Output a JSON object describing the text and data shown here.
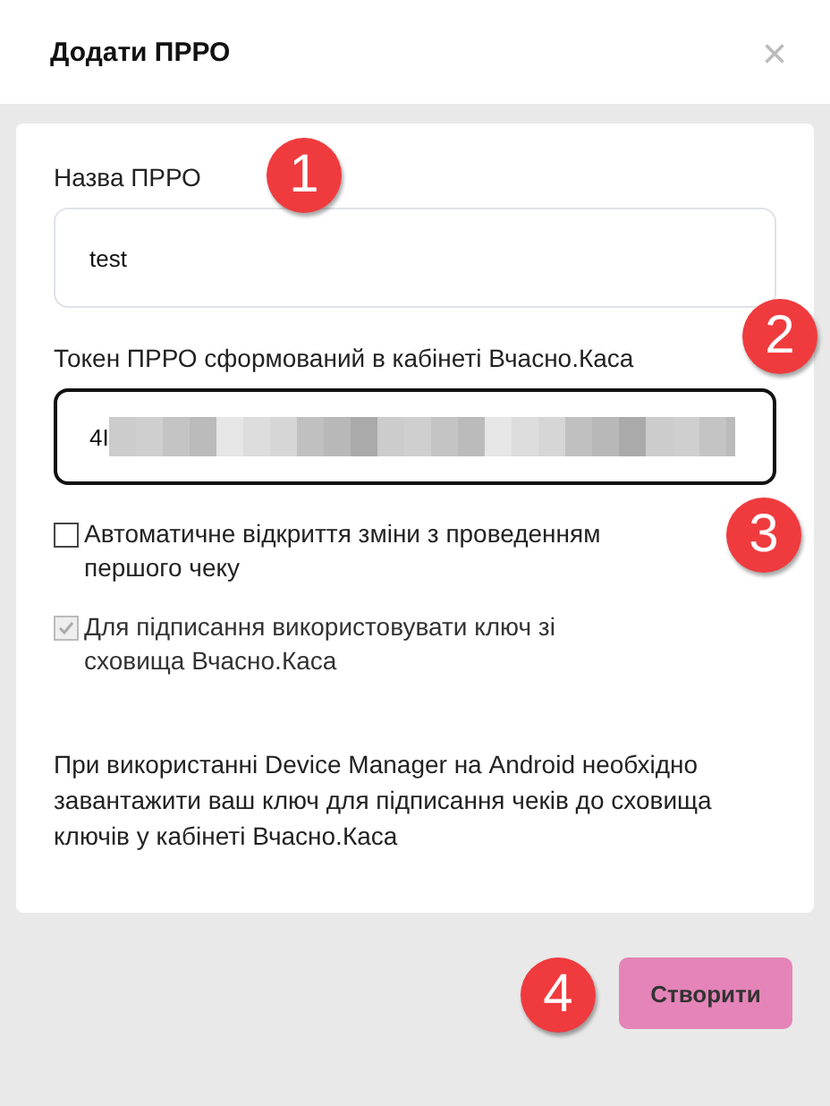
{
  "dialog": {
    "title": "Додати ПРРО",
    "close": "×"
  },
  "fields": [
    {
      "label": "Назва ПРРО",
      "value": "test",
      "focused": false
    },
    {
      "label": "Токен ПРРО сформований в кабінеті Вчасно.Каса",
      "value": "4I",
      "focused": true,
      "redacted": true
    }
  ],
  "checkboxes": [
    {
      "label": "Автоматичне відкриття зміни з проведенням першого чеку",
      "checked": false,
      "disabled": false
    },
    {
      "label": "Для підписання використовувати ключ зі сховища Вчасно.Каса",
      "checked": true,
      "disabled": true
    }
  ],
  "note": "При використанні Device Manager на Android необхідно завантажити ваш ключ для підписання чеків до сховища ключів у кабінеті Вчасно.Каса",
  "buttons": [
    {
      "label": "Створити"
    }
  ],
  "callouts": [
    "1",
    "2",
    "3",
    "4"
  ]
}
